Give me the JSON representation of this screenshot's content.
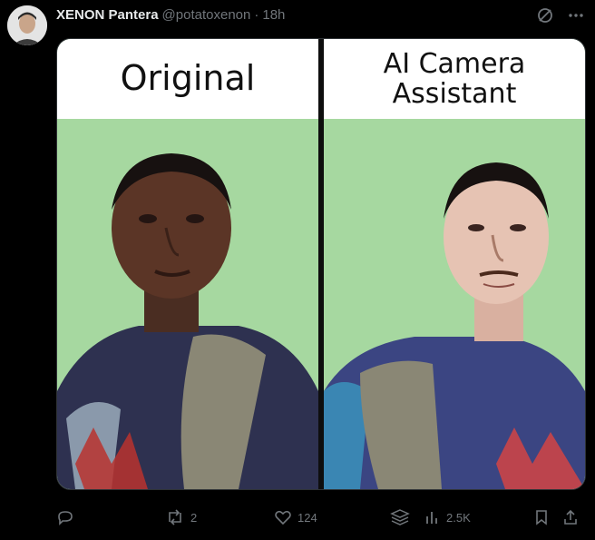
{
  "tweet": {
    "display_name": "XENON Pantera",
    "handle": "@potatoxenon",
    "separator": "·",
    "time": "18h",
    "media": {
      "left_label": "Original",
      "right_label": "AI Camera\nAssistant"
    },
    "actions": {
      "reply_count": "",
      "retweet_count": "2",
      "like_count": "124",
      "views_count": "2.5K"
    }
  },
  "icons": {
    "top_right": [
      "grok-icon",
      "more-icon"
    ],
    "actions": [
      "reply-icon",
      "retweet-icon",
      "like-icon",
      "stack-icon",
      "views-icon",
      "bookmark-icon",
      "share-icon"
    ]
  },
  "colors": {
    "background": "#000000",
    "text": "#e7e9ea",
    "muted": "#71767b",
    "panel_bg": "#a6d8a0"
  }
}
